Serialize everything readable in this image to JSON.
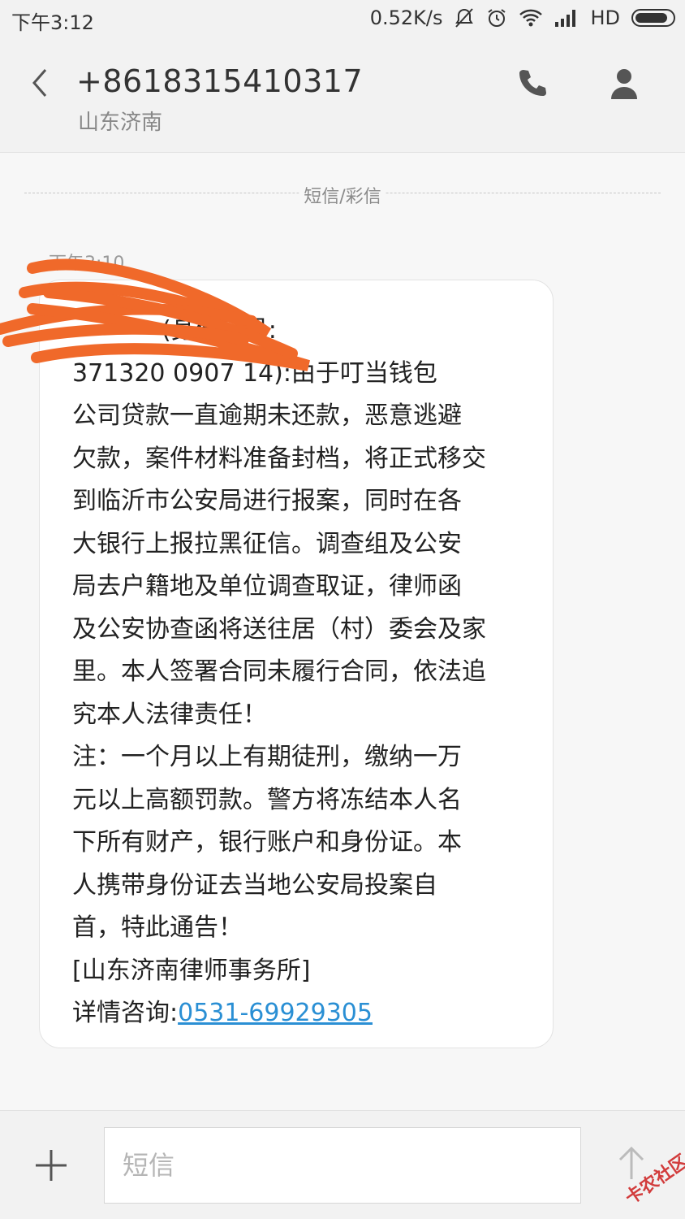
{
  "status_bar": {
    "time": "下午3:12",
    "net_speed": "0.52K/s",
    "network_label": "HD"
  },
  "header": {
    "number": "+8618315410317",
    "location": "山东济南"
  },
  "thread": {
    "divider_label": "短信/彩信",
    "message_time": "下午3:10",
    "lines": [
      "(身份证号:",
      "371320  0907  14):由于叮当钱包",
      "公司贷款一直逾期未还款，恶意逃避",
      "欠款，案件材料准备封档，将正式移交",
      "到临沂市公安局进行报案，同时在各",
      "大银行上报拉黑征信。调查组及公安",
      "局去户籍地及单位调查取证，律师函",
      "及公安协查函将送往居（村）委会及家",
      "里。本人签署合同未履行合同，依法追",
      "究本人法律责任！",
      "注：一个月以上有期徒刑，缴纳一万",
      "元以上高额罚款。警方将冻结本人名",
      "下所有财产，银行账户和身份证。本",
      "人携带身份证去当地公安局投案自",
      "首，特此通告！",
      "[山东济南律师事务所]"
    ],
    "last_line_prefix": "详情咨询:",
    "phone_link": "0531-69929305"
  },
  "compose": {
    "placeholder": "短信"
  },
  "watermark": "卡农社区",
  "colors": {
    "link": "#2a8fd4",
    "redaction": "#f0692a"
  }
}
